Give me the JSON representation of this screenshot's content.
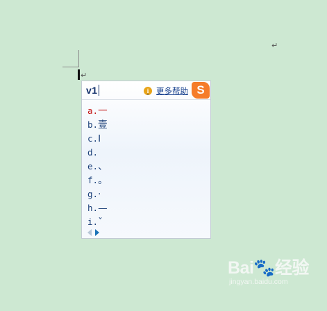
{
  "document": {
    "paragraph_mark": "↵"
  },
  "ime": {
    "input_text": "v1",
    "help_icon": "i",
    "help_label": "更多帮助",
    "logo_letter": "S",
    "candidates": [
      {
        "key": "a.",
        "value": "一"
      },
      {
        "key": "b.",
        "value": "壹"
      },
      {
        "key": "c.",
        "value": "Ⅰ"
      },
      {
        "key": "d.",
        "value": ""
      },
      {
        "key": "e.",
        "value": "、"
      },
      {
        "key": "f.",
        "value": "。"
      },
      {
        "key": "g.",
        "value": "·"
      },
      {
        "key": "h.",
        "value": "—"
      },
      {
        "key": "i.",
        "value": "ˇ"
      }
    ],
    "selected_index": 0,
    "colors": {
      "selected": "#c31414",
      "normal": "#1a3f78",
      "logo": "#f57c2a",
      "background": "#cde8d2"
    }
  },
  "watermark": {
    "logo_text": "Bai🐾经验",
    "url": "jingyan.baidu.com"
  }
}
